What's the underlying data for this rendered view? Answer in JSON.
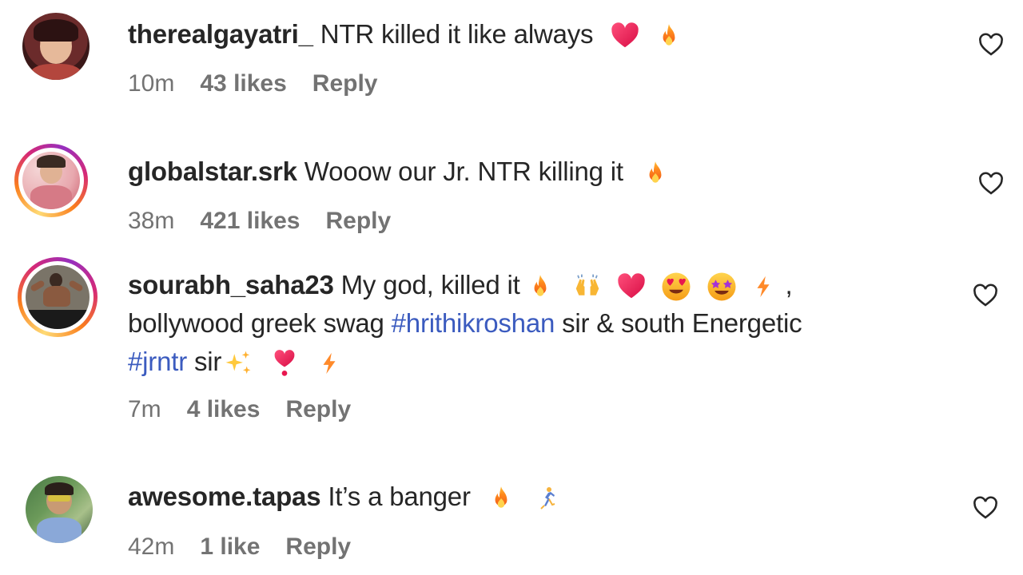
{
  "comments": [
    {
      "username": "therealgayatri_",
      "text": "NTR killed it like always",
      "time": "10m",
      "likes": "43 likes",
      "reply": "Reply",
      "emojis": [
        "red-heart-emoji",
        "fire-emoji"
      ]
    },
    {
      "username": "globalstar.srk",
      "text": "Wooow our Jr. NTR killing it",
      "time": "38m",
      "likes": "421 likes",
      "reply": "Reply",
      "emojis": [
        "fire-emoji"
      ]
    },
    {
      "username": "sourabh_saha23",
      "text_part1": "My god, killed it",
      "text_part2": ",",
      "line2_part1": "bollywood greek swag",
      "hashtag1": "#hrithikroshan",
      "line2_part2": "sir & south Energetic",
      "hashtag2": "#jrntr",
      "line3_part1": "sir",
      "time": "7m",
      "likes": "4 likes",
      "reply": "Reply",
      "emojis": [
        "fire-emoji",
        "raising-hands-emoji",
        "red-heart-emoji",
        "heart-eyes-emoji",
        "star-struck-emoji",
        "lightning-emoji",
        "sparkles-emoji",
        "heart-exclamation-emoji",
        "lightning-emoji"
      ]
    },
    {
      "username": "awesome.tapas",
      "text": "It’s a banger",
      "time": "42m",
      "likes": "1 like",
      "reply": "Reply",
      "emojis": [
        "fire-emoji",
        "dancer-emoji"
      ]
    }
  ],
  "colors": {
    "text": "#262626",
    "meta": "#737373",
    "hashtag": "#3b5bbf",
    "ring_start": "#feda75",
    "ring_end": "#d62976"
  },
  "icons": {
    "like": "heart-outline-icon"
  }
}
